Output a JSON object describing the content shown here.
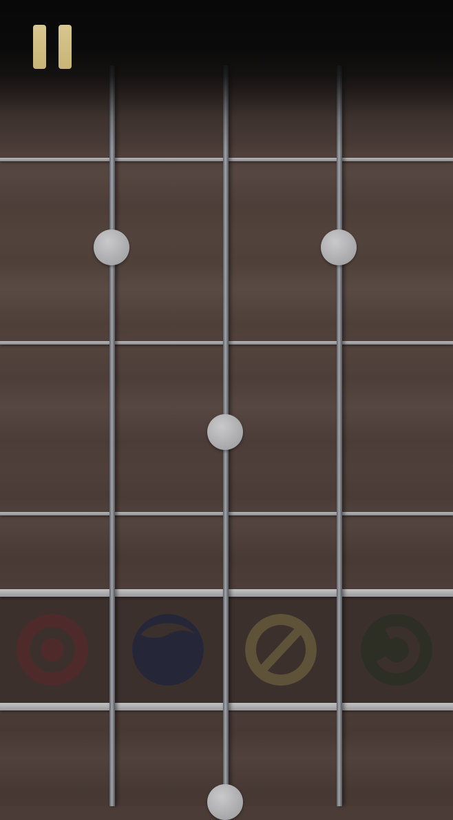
{
  "game": {
    "controls": {
      "pause_icon": "pause-icon",
      "pause_color": "#cdbb7e"
    },
    "fretboard": {
      "wood_color": "#4b3c37",
      "string_count": 4,
      "fret_count": 5,
      "inlay_color": "#b4b4b6"
    },
    "note_targets": [
      {
        "id": "red",
        "icon": "target-circle-icon",
        "color": "#4e2b2a"
      },
      {
        "id": "blue",
        "icon": "wave-circle-icon",
        "color": "#252739"
      },
      {
        "id": "olive",
        "icon": "slash-circle-icon",
        "color": "#5e5339"
      },
      {
        "id": "green",
        "icon": "hook-circle-icon",
        "color": "#2d2f25"
      }
    ]
  }
}
